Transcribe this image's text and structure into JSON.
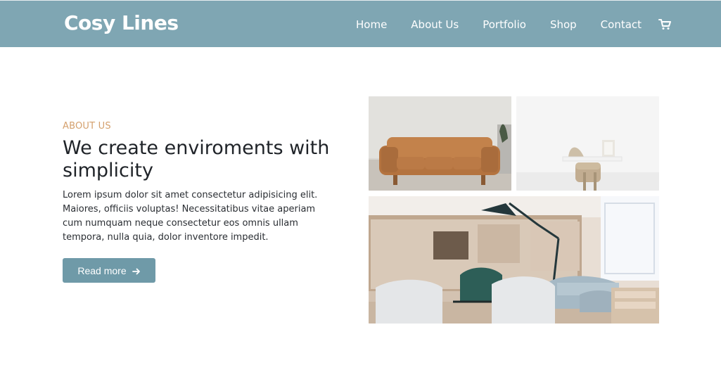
{
  "header": {
    "brand": "Cosy Lines",
    "nav": {
      "home": "Home",
      "about": "About Us",
      "portfolio": "Portfolio",
      "shop": "Shop",
      "contact": "Contact"
    },
    "cart_icon": "shopping-cart-icon",
    "background_color": "#7fa6b3"
  },
  "about": {
    "kicker": "ABOUT US",
    "headline": "We create enviroments with\nsimplicity",
    "body": "Lorem ipsum dolor sit amet consectetur adipisicing elit.\nMaiores, officiis voluptas! Necessitatibus vitae aperiam\ncum numquam neque consectetur eos omnis ullam\ntempora, nulla quia, dolor inventore impedit.",
    "button_label": "Read more",
    "button_icon": "arrow-right-icon",
    "accent_color": "#d4a06d",
    "button_color": "#6f9aa8"
  },
  "gallery": {
    "images": [
      "sofa-image",
      "desk-image",
      "lounge-image"
    ]
  }
}
